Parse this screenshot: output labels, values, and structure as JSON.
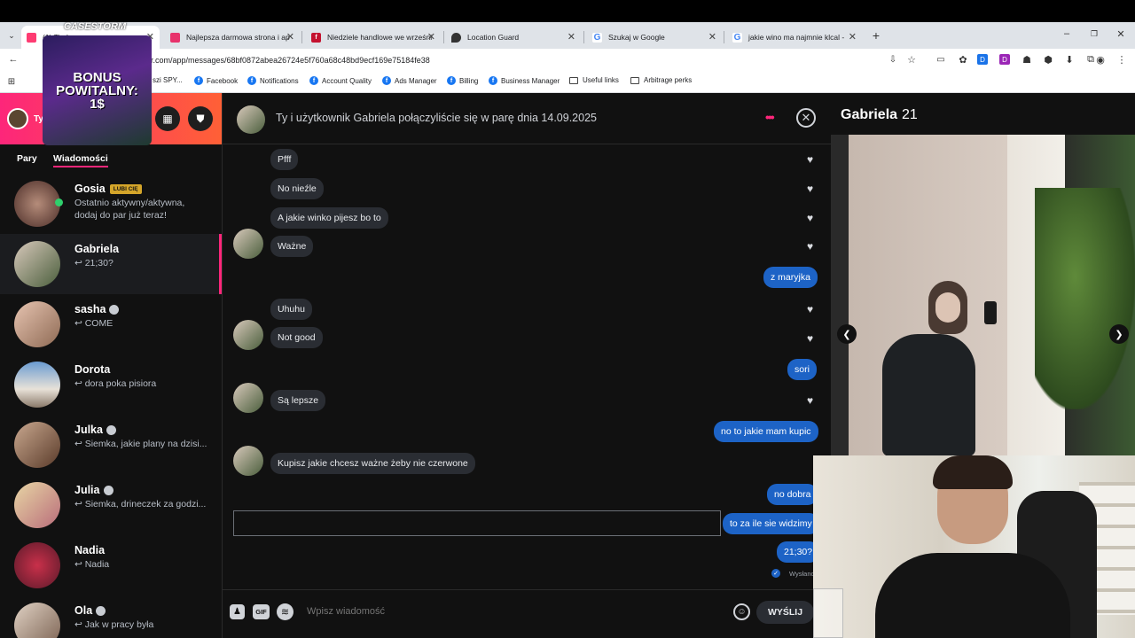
{
  "browser": {
    "tabs": [
      {
        "title": "(1) Tinder",
        "active": true
      },
      {
        "title": "Najlepsza darmowa strona i ap"
      },
      {
        "title": "Niedziele handlowe we wrześni"
      },
      {
        "title": "Location Guard"
      },
      {
        "title": "Szukaj w Google"
      },
      {
        "title": "jakie wino ma najmnie klcal -"
      }
    ],
    "url": "r.com/app/messages/68bf0872abea26724e5f760a68c48bd9ecf169e75184fe38",
    "bookmarks": [
      "szi SPY...",
      "Facebook",
      "Notifications",
      "Account Quality",
      "Ads Manager",
      "Billing",
      "Business Manager",
      "Useful links",
      "Arbitrage perks"
    ]
  },
  "overlay": {
    "brand": "CASESTORM",
    "promo_line1": "BONUS",
    "promo_line2": "POWITALNY:",
    "promo_line3": "1$"
  },
  "sidebar": {
    "header_name": "Ty",
    "tabs": [
      "Pary",
      "Wiadomości"
    ],
    "active_tab": "Wiadomości",
    "matches": [
      {
        "name": "Gosia",
        "badge": "LUBI CIĘ",
        "line1": "Ostatnio aktywny/aktywna,",
        "line2": "dodaj do par już teraz!"
      },
      {
        "name": "Gabriela",
        "preview": "↩ 21;30?"
      },
      {
        "name": "sasha",
        "preview": "↩ COME"
      },
      {
        "name": "Dorota",
        "preview": "↩ dora poka pisiora"
      },
      {
        "name": "Julka",
        "preview": "↩ Siemka, jakie plany na dzisi..."
      },
      {
        "name": "Julia",
        "preview": "↩ Siemka, drineczek za godzi..."
      },
      {
        "name": "Nadia",
        "preview": "↩ Nadia"
      },
      {
        "name": "Ola",
        "preview": "↩ Jak w pracy była"
      }
    ]
  },
  "chat": {
    "header": "Ty i użytkownik Gabriela połączyliście się w parę dnia 14.09.2025",
    "messages": [
      {
        "from": "them",
        "text": "Pfff"
      },
      {
        "from": "them",
        "text": "No nieźle"
      },
      {
        "from": "them",
        "text": "A jakie winko pijesz bo to"
      },
      {
        "from": "them",
        "text": "Ważne"
      },
      {
        "from": "me",
        "text": "z maryjka"
      },
      {
        "from": "them",
        "text": "Uhuhu"
      },
      {
        "from": "them",
        "text": "Not good"
      },
      {
        "from": "me",
        "text": "sori"
      },
      {
        "from": "them",
        "text": "Są lepsze"
      },
      {
        "from": "me",
        "text": "no to jakie mam kupic"
      },
      {
        "from": "them",
        "text": "Kupisz jakie chcesz ważne żeby nie czerwone"
      },
      {
        "from": "me",
        "text": "no dobra"
      },
      {
        "from": "me",
        "text": "to za ile sie widzimy"
      },
      {
        "from": "me",
        "text": "21;30?"
      }
    ],
    "status": "Wysłano",
    "composer_placeholder": "Wpisz wiadomość",
    "gif_label": "GIF",
    "send_label": "WYŚLIJ"
  },
  "profile": {
    "name": "Gabriela",
    "age": "21"
  },
  "colors": {
    "tinder_gradient_start": "#fd267a",
    "tinder_gradient_end": "#ff6036",
    "my_bubble": "#1d63c6",
    "their_bubble": "#2a2d33",
    "background": "#111111"
  }
}
